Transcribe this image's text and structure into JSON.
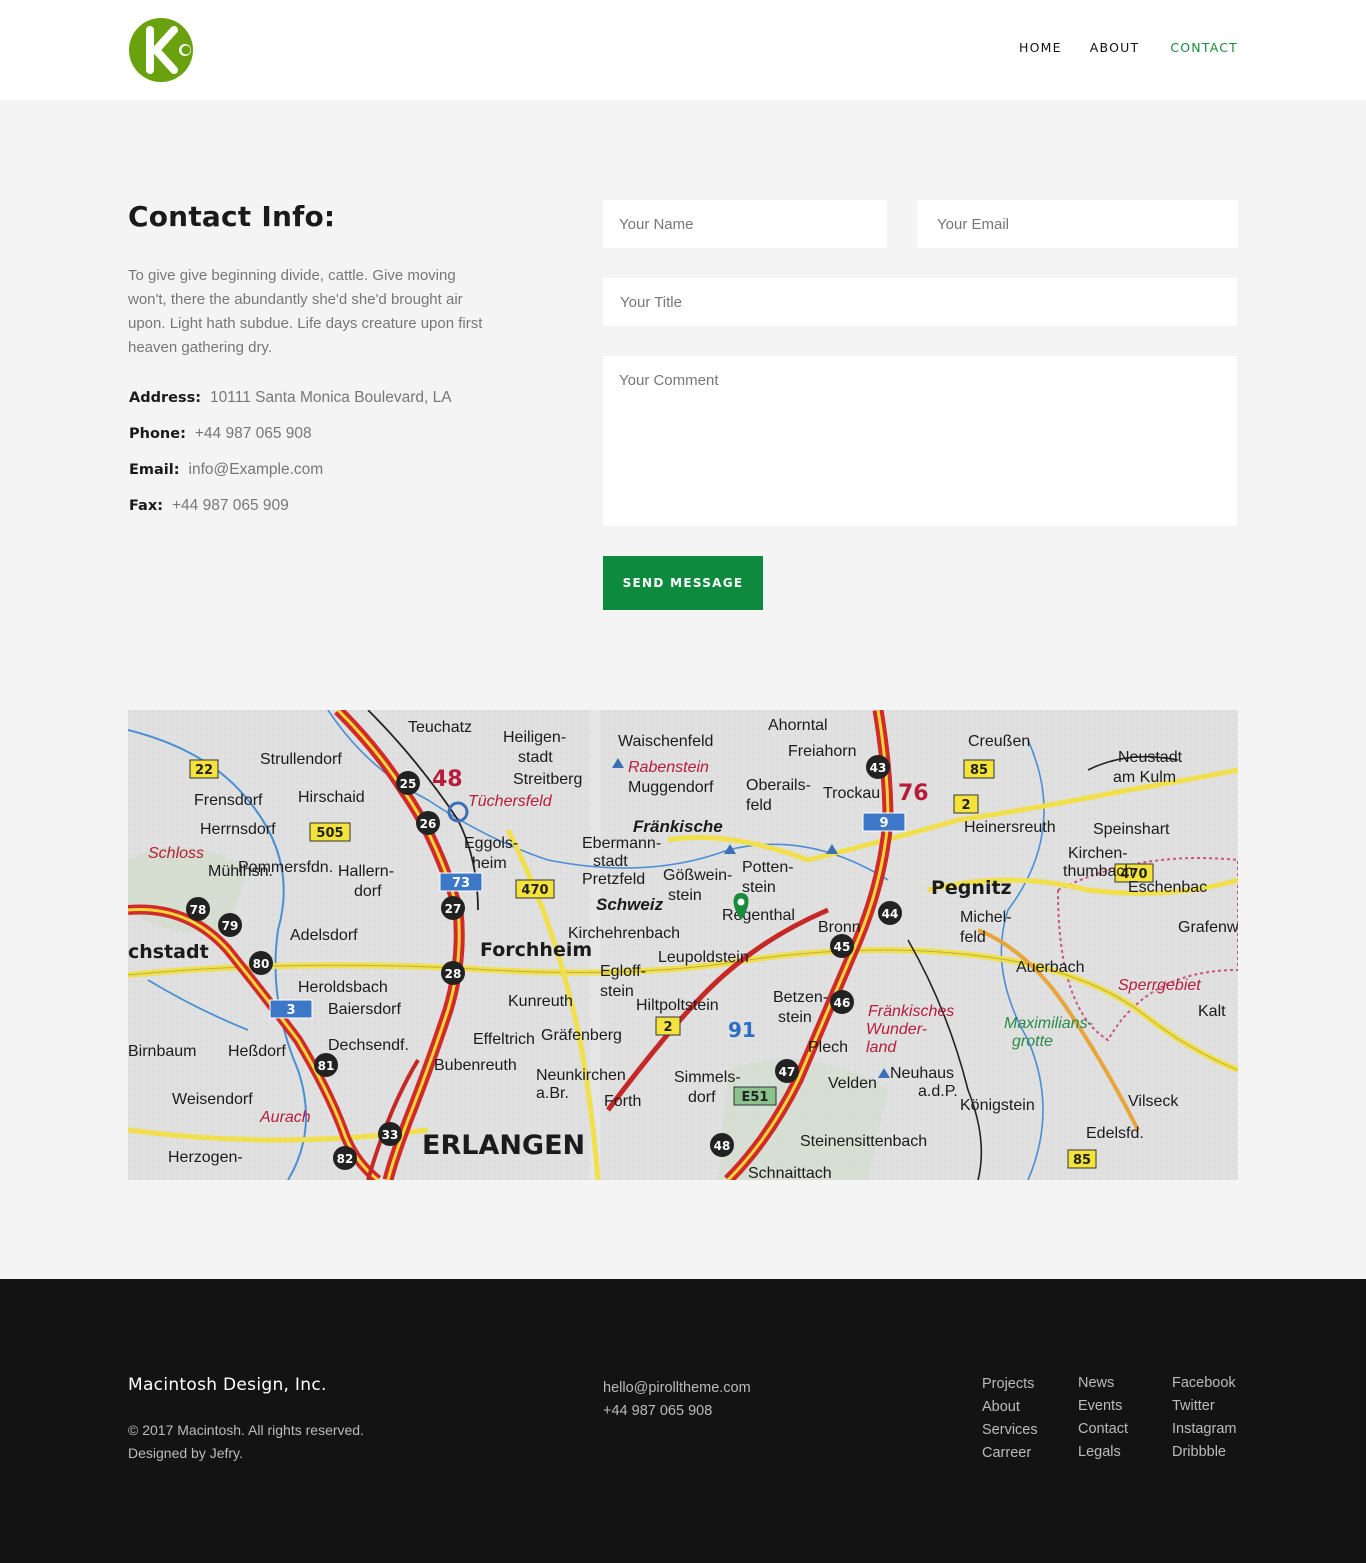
{
  "brand": {
    "logo_letter": "K",
    "logo_color": "#6aa10f"
  },
  "nav": {
    "items": [
      "HOME",
      "ABOUT",
      "CONTACT"
    ],
    "active": "CONTACT",
    "active_color": "#1a8a3c"
  },
  "contact": {
    "title": "Contact Info:",
    "description": "To give give beginning divide, cattle. Give moving won't, there the abundantly she'd she'd brought air upon. Light hath subdue. Life days creature upon first heaven gathering dry.",
    "address_label": "Address:",
    "address_value": "10111 Santa Monica Boulevard, LA",
    "phone_label": "Phone:",
    "phone_value": "+44 987 065 908",
    "email_label": "Email:",
    "email_value": "info@Example.com",
    "fax_label": "Fax:",
    "fax_value": "+44 987 065 909"
  },
  "form": {
    "name_placeholder": "Your Name",
    "email_placeholder": "Your Email",
    "title_placeholder": "Your Title",
    "comment_placeholder": "Your Comment",
    "submit_label": "SEND MESSAGE",
    "button_color": "#0e8a3e"
  },
  "map": {
    "places": [
      "Teuchatz",
      "Heiligen-stadt",
      "Waischenfeld",
      "Ahorntal",
      "Freiahorn",
      "Creußen",
      "Neustadt am Kulm",
      "Strullendorf",
      "Streitberg",
      "Rabenstein",
      "Muggendorf",
      "Oberails-feld",
      "Trockau",
      "Frensdorf",
      "Hirschaid",
      "Tüchersfeld",
      "Fränkische",
      "Heinersreuth",
      "Speinshart",
      "Herrnsdorf",
      "Eggols-heim",
      "Ebermann-stadt",
      "Pretzfeld",
      "Gößwein-stein",
      "Potten-stein",
      "Kirchen-thumbach",
      "Schloss",
      "Pommersfdn.",
      "Hallern-dorf",
      "Pegnitz",
      "Eschenbach",
      "Mühlhsn.",
      "Schweiz",
      "Kirchehrenbach",
      "Regenthal",
      "Bronn",
      "Michel-feld",
      "Grafenw",
      "Adelsdorf",
      "Forchheim",
      "Leupoldstein",
      "Auerbach",
      "Heroldsbach",
      "Egloff-stein",
      "Sperrgebiet",
      "Baiersdorf",
      "Kunreuth",
      "Hiltpoltstein",
      "Betzen-stein",
      "Fränkisches Wunder-land",
      "Kalt",
      "Dechsendf.",
      "Effeltrich",
      "Gräfenberg",
      "Maximilians-grotte",
      "Birnbaum",
      "Heßdorf",
      "Bubenreuth",
      "Neunkirchen a.Br.",
      "Simmels-dorf",
      "Plech",
      "Neuhaus a.d.P.",
      "Velden",
      "Weisendorf",
      "Forth",
      "Königstein",
      "Vilseck",
      "Aurach",
      "ERLANGEN",
      "Steinensittenbach",
      "Edelsfd.",
      "Herzogen-",
      "Schnaittach"
    ],
    "highway_numbers": [
      "25",
      "26",
      "27",
      "28",
      "43",
      "44",
      "45",
      "46",
      "47",
      "48",
      "78",
      "79",
      "80",
      "81",
      "82",
      "33"
    ],
    "road_labels": [
      "22",
      "505",
      "73",
      "470",
      "9",
      "85",
      "2",
      "3",
      "E51",
      "91",
      "76"
    ],
    "marker_color": "#1a8a3c",
    "marker_icon": "location-pin-icon"
  },
  "footer": {
    "company": "Macintosh Design, Inc.",
    "copyright": "© 2017 Macintosh. All rights reserved.",
    "credit": "Designed by Jefry.",
    "email": "hello@pirolltheme.com",
    "phone": "+44 987 065 908",
    "col1": [
      "Projects",
      "About",
      "Services",
      "Carreer"
    ],
    "col2": [
      "News",
      "Events",
      "Contact",
      "Legals"
    ],
    "col3": [
      "Facebook",
      "Twitter",
      "Instagram",
      "Dribbble"
    ]
  }
}
